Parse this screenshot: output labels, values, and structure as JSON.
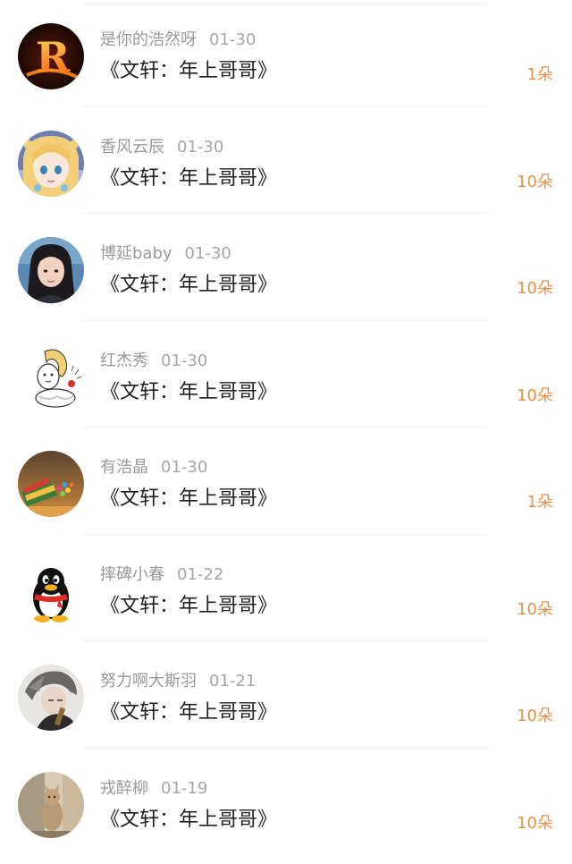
{
  "items": [
    {
      "name": "是你的浩然呀",
      "date": "01-30",
      "title": "《文轩：年上哥哥》",
      "amount": "1朵",
      "avatar": "fire-letter-r-avatar"
    },
    {
      "name": "香风云辰",
      "date": "01-30",
      "title": "《文轩：年上哥哥》",
      "amount": "10朵",
      "avatar": "anime-girl-avatar"
    },
    {
      "name": "博延baby",
      "date": "01-30",
      "title": "《文轩：年上哥哥》",
      "amount": "10朵",
      "avatar": "photo-girl-avatar"
    },
    {
      "name": "红杰秀",
      "date": "01-30",
      "title": "《文轩：年上哥哥》",
      "amount": "10朵",
      "avatar": "cartoon-character-avatar"
    },
    {
      "name": "有浩晶",
      "date": "01-30",
      "title": "《文轩：年上哥哥》",
      "amount": "1朵",
      "avatar": "candy-jar-avatar"
    },
    {
      "name": "摔碑小春",
      "date": "01-22",
      "title": "《文轩：年上哥哥》",
      "amount": "10朵",
      "avatar": "qq-penguin-avatar"
    },
    {
      "name": "努力啊大斯羽",
      "date": "01-21",
      "title": "《文轩：年上哥哥》",
      "amount": "10朵",
      "avatar": "anime-man-avatar"
    },
    {
      "name": "戎醉柳",
      "date": "01-19",
      "title": "《文轩：年上哥哥》",
      "amount": "10朵",
      "avatar": "cat-photo-avatar"
    }
  ],
  "colors": {
    "amount": "#e79049",
    "meta": "#9a9a9a",
    "title": "#222222"
  }
}
